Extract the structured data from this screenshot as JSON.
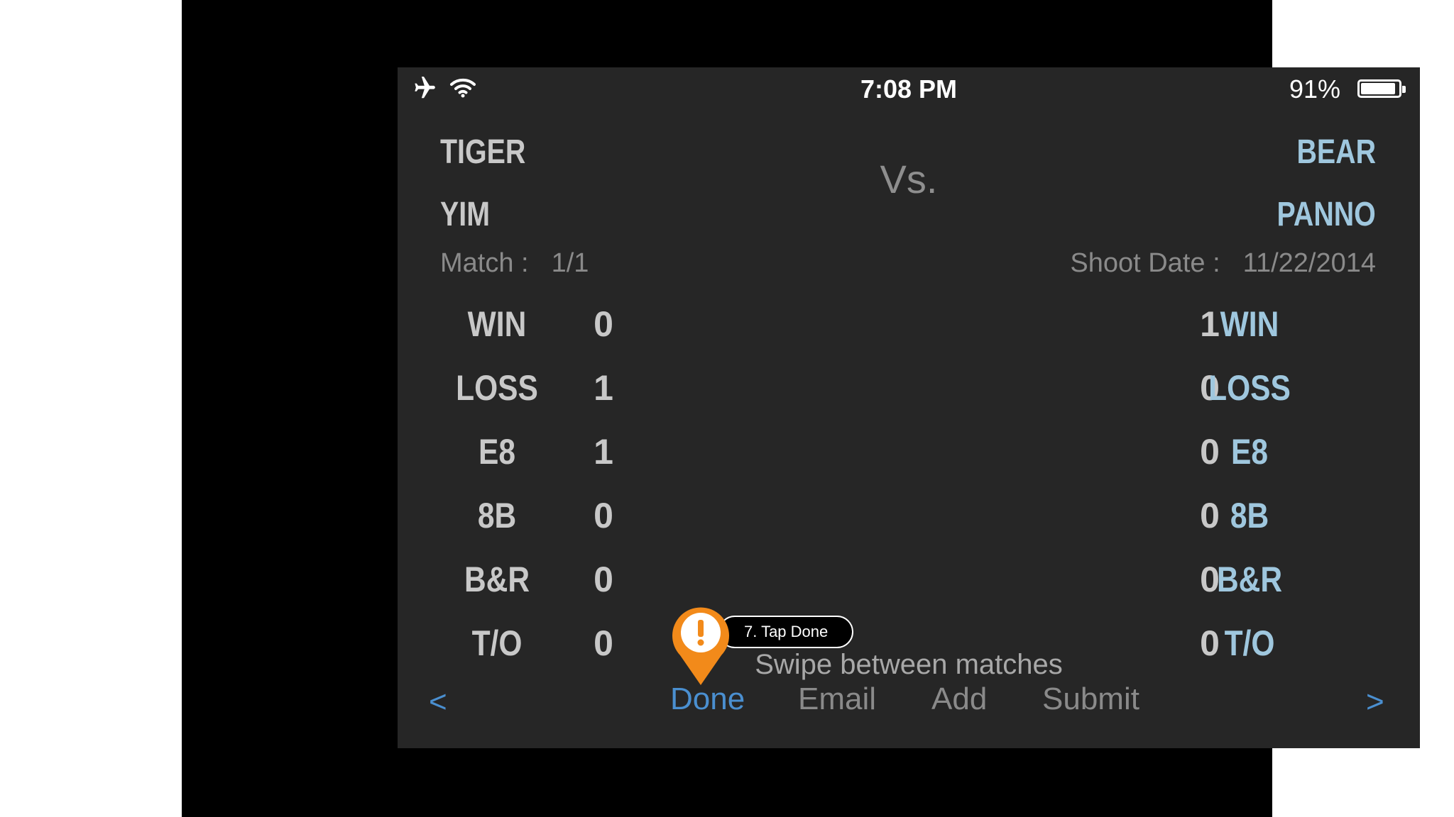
{
  "status_bar": {
    "time": "7:08 PM",
    "battery": "91%"
  },
  "left_player": {
    "first": "TIGER",
    "last": "YIM"
  },
  "right_player": {
    "first": "BEAR",
    "last": "PANNO"
  },
  "vs": "Vs.",
  "match": {
    "label": "Match :",
    "value": "1/1"
  },
  "shoot_date": {
    "label": "Shoot Date :",
    "value": "11/22/2014"
  },
  "stats": [
    {
      "label": "WIN",
      "left": "0",
      "right": "1"
    },
    {
      "label": "LOSS",
      "left": "1",
      "right": "0"
    },
    {
      "label": "E8",
      "left": "1",
      "right": "0"
    },
    {
      "label": "8B",
      "left": "0",
      "right": "0"
    },
    {
      "label": "B&R",
      "left": "0",
      "right": "0"
    },
    {
      "label": "T/O",
      "left": "0",
      "right": "0"
    }
  ],
  "tooltip": {
    "text": "7. Tap Done",
    "icon": "exclamation-icon"
  },
  "swipe_hint": "Swipe between matches",
  "toolbar": {
    "prev": "<",
    "next": ">",
    "done": "Done",
    "email": "Email",
    "add": "Add",
    "submit": "Submit"
  },
  "colors": {
    "accent": "#4a8fd0",
    "right_team": "#9fc7de",
    "tooltip_pin": "#f28a1a",
    "background": "#262626"
  }
}
